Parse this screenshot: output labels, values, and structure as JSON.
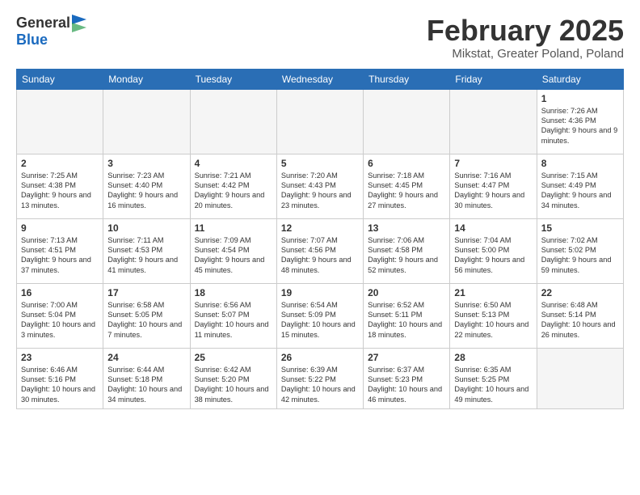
{
  "header": {
    "logo_general": "General",
    "logo_blue": "Blue",
    "month_title": "February 2025",
    "location": "Mikstat, Greater Poland, Poland"
  },
  "days_of_week": [
    "Sunday",
    "Monday",
    "Tuesday",
    "Wednesday",
    "Thursday",
    "Friday",
    "Saturday"
  ],
  "weeks": [
    [
      {
        "day": "",
        "info": ""
      },
      {
        "day": "",
        "info": ""
      },
      {
        "day": "",
        "info": ""
      },
      {
        "day": "",
        "info": ""
      },
      {
        "day": "",
        "info": ""
      },
      {
        "day": "",
        "info": ""
      },
      {
        "day": "1",
        "info": "Sunrise: 7:26 AM\nSunset: 4:36 PM\nDaylight: 9 hours and 9 minutes."
      }
    ],
    [
      {
        "day": "2",
        "info": "Sunrise: 7:25 AM\nSunset: 4:38 PM\nDaylight: 9 hours and 13 minutes."
      },
      {
        "day": "3",
        "info": "Sunrise: 7:23 AM\nSunset: 4:40 PM\nDaylight: 9 hours and 16 minutes."
      },
      {
        "day": "4",
        "info": "Sunrise: 7:21 AM\nSunset: 4:42 PM\nDaylight: 9 hours and 20 minutes."
      },
      {
        "day": "5",
        "info": "Sunrise: 7:20 AM\nSunset: 4:43 PM\nDaylight: 9 hours and 23 minutes."
      },
      {
        "day": "6",
        "info": "Sunrise: 7:18 AM\nSunset: 4:45 PM\nDaylight: 9 hours and 27 minutes."
      },
      {
        "day": "7",
        "info": "Sunrise: 7:16 AM\nSunset: 4:47 PM\nDaylight: 9 hours and 30 minutes."
      },
      {
        "day": "8",
        "info": "Sunrise: 7:15 AM\nSunset: 4:49 PM\nDaylight: 9 hours and 34 minutes."
      }
    ],
    [
      {
        "day": "9",
        "info": "Sunrise: 7:13 AM\nSunset: 4:51 PM\nDaylight: 9 hours and 37 minutes."
      },
      {
        "day": "10",
        "info": "Sunrise: 7:11 AM\nSunset: 4:53 PM\nDaylight: 9 hours and 41 minutes."
      },
      {
        "day": "11",
        "info": "Sunrise: 7:09 AM\nSunset: 4:54 PM\nDaylight: 9 hours and 45 minutes."
      },
      {
        "day": "12",
        "info": "Sunrise: 7:07 AM\nSunset: 4:56 PM\nDaylight: 9 hours and 48 minutes."
      },
      {
        "day": "13",
        "info": "Sunrise: 7:06 AM\nSunset: 4:58 PM\nDaylight: 9 hours and 52 minutes."
      },
      {
        "day": "14",
        "info": "Sunrise: 7:04 AM\nSunset: 5:00 PM\nDaylight: 9 hours and 56 minutes."
      },
      {
        "day": "15",
        "info": "Sunrise: 7:02 AM\nSunset: 5:02 PM\nDaylight: 9 hours and 59 minutes."
      }
    ],
    [
      {
        "day": "16",
        "info": "Sunrise: 7:00 AM\nSunset: 5:04 PM\nDaylight: 10 hours and 3 minutes."
      },
      {
        "day": "17",
        "info": "Sunrise: 6:58 AM\nSunset: 5:05 PM\nDaylight: 10 hours and 7 minutes."
      },
      {
        "day": "18",
        "info": "Sunrise: 6:56 AM\nSunset: 5:07 PM\nDaylight: 10 hours and 11 minutes."
      },
      {
        "day": "19",
        "info": "Sunrise: 6:54 AM\nSunset: 5:09 PM\nDaylight: 10 hours and 15 minutes."
      },
      {
        "day": "20",
        "info": "Sunrise: 6:52 AM\nSunset: 5:11 PM\nDaylight: 10 hours and 18 minutes."
      },
      {
        "day": "21",
        "info": "Sunrise: 6:50 AM\nSunset: 5:13 PM\nDaylight: 10 hours and 22 minutes."
      },
      {
        "day": "22",
        "info": "Sunrise: 6:48 AM\nSunset: 5:14 PM\nDaylight: 10 hours and 26 minutes."
      }
    ],
    [
      {
        "day": "23",
        "info": "Sunrise: 6:46 AM\nSunset: 5:16 PM\nDaylight: 10 hours and 30 minutes."
      },
      {
        "day": "24",
        "info": "Sunrise: 6:44 AM\nSunset: 5:18 PM\nDaylight: 10 hours and 34 minutes."
      },
      {
        "day": "25",
        "info": "Sunrise: 6:42 AM\nSunset: 5:20 PM\nDaylight: 10 hours and 38 minutes."
      },
      {
        "day": "26",
        "info": "Sunrise: 6:39 AM\nSunset: 5:22 PM\nDaylight: 10 hours and 42 minutes."
      },
      {
        "day": "27",
        "info": "Sunrise: 6:37 AM\nSunset: 5:23 PM\nDaylight: 10 hours and 46 minutes."
      },
      {
        "day": "28",
        "info": "Sunrise: 6:35 AM\nSunset: 5:25 PM\nDaylight: 10 hours and 49 minutes."
      },
      {
        "day": "",
        "info": ""
      }
    ]
  ]
}
